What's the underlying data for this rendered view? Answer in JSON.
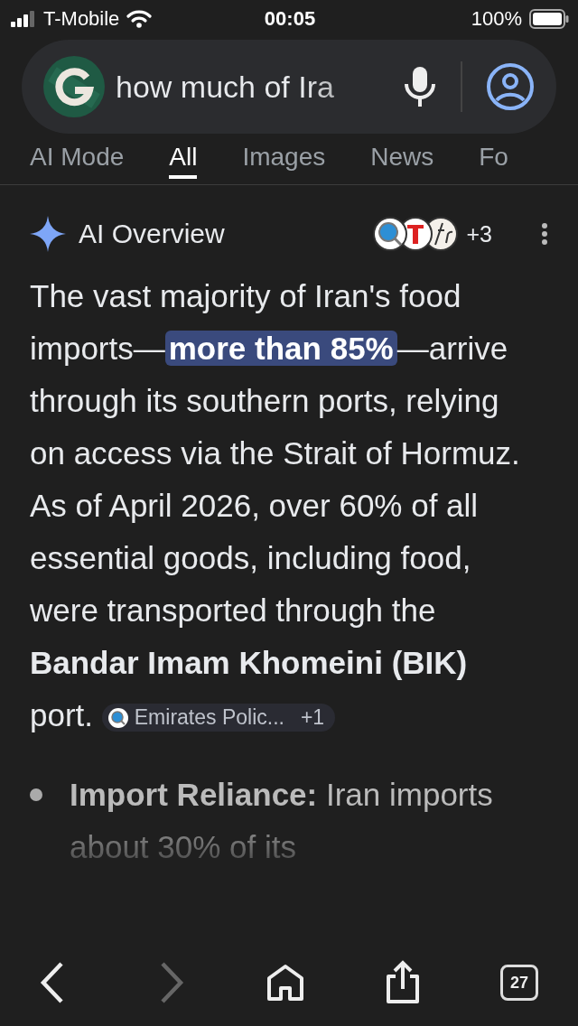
{
  "status_bar": {
    "carrier": "T-Mobile",
    "time": "00:05",
    "battery": "100%"
  },
  "search": {
    "query": "how much of Ira"
  },
  "tabs": [
    {
      "label": "AI Mode",
      "selected": false
    },
    {
      "label": "All",
      "selected": true
    },
    {
      "label": "Images",
      "selected": false
    },
    {
      "label": "News",
      "selected": false
    },
    {
      "label": "Fo",
      "selected": false
    }
  ],
  "overview": {
    "title": "AI Overview",
    "sources_more": "+3",
    "text_before": "The vast majority of Iran's food imports—",
    "highlight": "more than 85%",
    "text_after": "—arrive through its southern ports, relying on access via the Strait of Hormuz. As of April 2026, over 60% of all essential goods, including food, were transported through the **Bandar Imam Khomeini (BIK)** port.",
    "citation": {
      "label": "Emirates Polic...",
      "more": "+1"
    }
  },
  "bullets": [
    {
      "text": "**Import Reliance:** Iran imports about 30% of its"
    }
  ],
  "toolbar": {
    "back_disabled": false,
    "forward_disabled": true,
    "tab_count": "27"
  }
}
